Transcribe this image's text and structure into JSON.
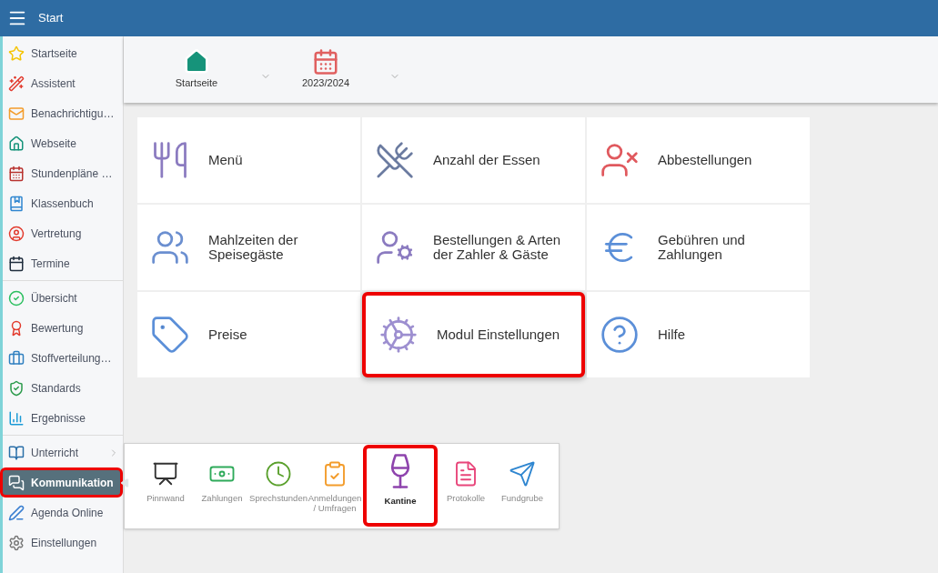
{
  "header": {
    "title": "Start"
  },
  "sidebar": {
    "groups": [
      [
        {
          "label": "Startseite",
          "selected": false,
          "highlighted": false
        },
        {
          "label": "Assistent",
          "selected": false,
          "highlighted": false
        },
        {
          "label": "Benachrichtigu…",
          "selected": false,
          "highlighted": false
        },
        {
          "label": "Webseite",
          "selected": false,
          "highlighted": false
        },
        {
          "label": "Stundenpläne …",
          "selected": false,
          "highlighted": false
        },
        {
          "label": "Klassenbuch",
          "selected": false,
          "highlighted": false
        },
        {
          "label": "Vertretung",
          "selected": false,
          "highlighted": false
        },
        {
          "label": "Termine",
          "selected": false,
          "highlighted": false
        }
      ],
      [
        {
          "label": "Übersicht",
          "selected": false,
          "highlighted": false
        },
        {
          "label": "Bewertung",
          "selected": false,
          "highlighted": false
        },
        {
          "label": "Stoffverteilung…",
          "selected": false,
          "highlighted": false
        },
        {
          "label": "Standards",
          "selected": false,
          "highlighted": false
        },
        {
          "label": "Ergebnisse",
          "selected": false,
          "highlighted": false
        }
      ],
      [
        {
          "label": "Unterricht",
          "selected": false,
          "highlighted": false
        },
        {
          "label": "Kommunikation",
          "selected": true,
          "highlighted": true
        },
        {
          "label": "Agenda Online",
          "selected": false,
          "highlighted": false
        },
        {
          "label": "Einstellungen",
          "selected": false,
          "highlighted": false
        }
      ]
    ]
  },
  "top_bar": [
    {
      "label": "Startseite"
    },
    {
      "label": "2023/2024"
    }
  ],
  "tiles": [
    {
      "label": "Menü",
      "highlighted": false
    },
    {
      "label": "Anzahl der Essen",
      "highlighted": false
    },
    {
      "label": "Abbestellungen",
      "highlighted": false
    },
    {
      "label": "Mahlzeiten der Speisegäste",
      "highlighted": false
    },
    {
      "label": "Bestellungen & Arten der Zahler & Gäste",
      "highlighted": false
    },
    {
      "label": "Gebühren und Zahlungen",
      "highlighted": false
    },
    {
      "label": "Preise",
      "highlighted": false
    },
    {
      "label": "Modul Einstellungen",
      "highlighted": true
    },
    {
      "label": "Hilfe",
      "highlighted": false
    }
  ],
  "module_menu": [
    {
      "label": "Pinnwand",
      "selected": false,
      "highlighted": false
    },
    {
      "label": "Zahlungen",
      "selected": false,
      "highlighted": false
    },
    {
      "label": "Sprechstunden",
      "selected": false,
      "highlighted": false
    },
    {
      "label": "Anmeldungen / Umfragen",
      "selected": false,
      "highlighted": false
    },
    {
      "label": "Kantine",
      "selected": true,
      "highlighted": true
    },
    {
      "label": "Protokolle",
      "selected": false,
      "highlighted": false
    },
    {
      "label": "Fundgrube",
      "selected": false,
      "highlighted": false
    }
  ]
}
